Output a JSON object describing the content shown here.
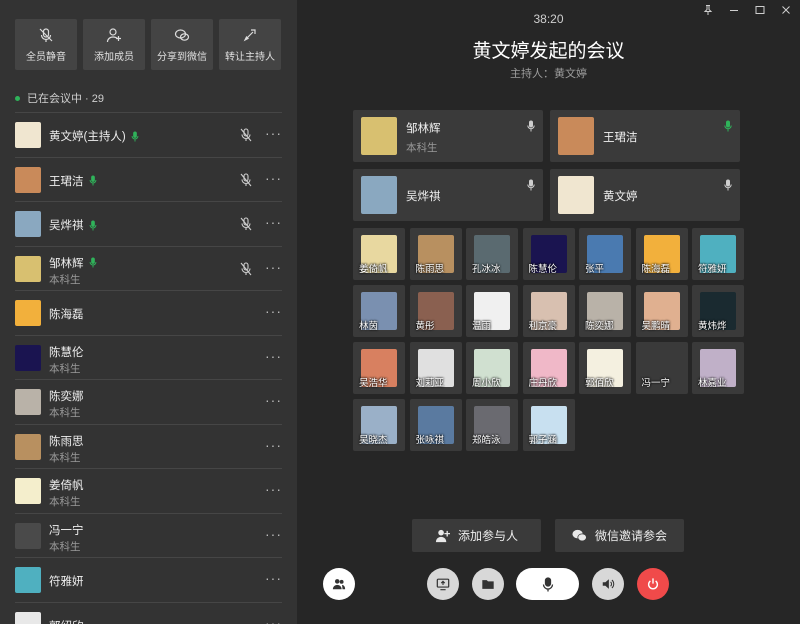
{
  "toolbar": {
    "mute_all": "全员静音",
    "add_member": "添加成员",
    "share_wechat": "分享到微信",
    "transfer_host": "转让主持人"
  },
  "status": {
    "in_meeting": "已在会议中 · 29"
  },
  "members": [
    {
      "name": "黄文婷(主持人)",
      "sub": "",
      "speaking": true,
      "muted": true,
      "color": "#f0e6d0"
    },
    {
      "name": "王珺洁",
      "sub": "",
      "speaking": true,
      "muted": true,
      "color": "#c98a5a"
    },
    {
      "name": "吴烨祺",
      "sub": "",
      "speaking": true,
      "muted": true,
      "color": "#8aa8c0"
    },
    {
      "name": "邹林辉",
      "sub": "本科生",
      "speaking": true,
      "muted": true,
      "color": "#d8c070"
    },
    {
      "name": "陈海磊",
      "sub": "",
      "speaking": false,
      "muted": false,
      "color": "#f2b03c"
    },
    {
      "name": "陈慧伦",
      "sub": "本科生",
      "speaking": false,
      "muted": false,
      "color": "#1a1450"
    },
    {
      "name": "陈奕娜",
      "sub": "本科生",
      "speaking": false,
      "muted": false,
      "color": "#b9b2a8"
    },
    {
      "name": "陈雨思",
      "sub": "本科生",
      "speaking": false,
      "muted": false,
      "color": "#b89060"
    },
    {
      "name": "姜倚帆",
      "sub": "本科生",
      "speaking": false,
      "muted": false,
      "color": "#f4eecc"
    },
    {
      "name": "冯一宁",
      "sub": "本科生",
      "speaking": false,
      "muted": false,
      "color": "#4a4a4a"
    },
    {
      "name": "符雅妍",
      "sub": "",
      "speaking": false,
      "muted": false,
      "color": "#4fb0c0"
    },
    {
      "name": "郭绍欣",
      "sub": "",
      "speaking": false,
      "muted": false,
      "color": "#e8e8e8"
    }
  ],
  "window": {
    "time": "38:20",
    "title": "黄文婷发起的会议",
    "host": "主持人：黄文婷"
  },
  "featured": [
    {
      "name": "邹林辉",
      "sub": "本科生",
      "mic_active": false,
      "color": "#d8c070"
    },
    {
      "name": "王珺洁",
      "sub": "",
      "mic_active": true,
      "color": "#c98a5a"
    },
    {
      "name": "吴烨祺",
      "sub": "",
      "mic_active": false,
      "color": "#8aa8c0"
    },
    {
      "name": "黄文婷",
      "sub": "",
      "mic_active": false,
      "color": "#f0e6d0"
    }
  ],
  "grid": [
    {
      "name": "姜倚帆",
      "color": "#e8d8a0"
    },
    {
      "name": "陈雨思",
      "color": "#b89060"
    },
    {
      "name": "孔冰冰",
      "color": "#5a6a70"
    },
    {
      "name": "陈慧伦",
      "color": "#1a1450"
    },
    {
      "name": "张平",
      "color": "#4a7ab0"
    },
    {
      "name": "陈海磊",
      "color": "#f2b03c"
    },
    {
      "name": "符雅妍",
      "color": "#4fb0c0"
    },
    {
      "name": "林茵",
      "color": "#7a90b0"
    },
    {
      "name": "黄彤",
      "color": "#8a6050"
    },
    {
      "name": "温雨",
      "color": "#f0f0f0"
    },
    {
      "name": "利京豪",
      "color": "#d8c0b0"
    },
    {
      "name": "陈奕娜",
      "color": "#b9b2a8"
    },
    {
      "name": "吴鹏晴",
      "color": "#e0b090"
    },
    {
      "name": "黄炜烨",
      "color": "#1a2a30"
    },
    {
      "name": "吴浩华",
      "color": "#d88060"
    },
    {
      "name": "刘莉亚",
      "color": "#e0e0e0"
    },
    {
      "name": "周小欣",
      "color": "#d0e0d0"
    },
    {
      "name": "庄丹欣",
      "color": "#f0b8c8"
    },
    {
      "name": "郭佰欣",
      "color": "#f4f0e0"
    },
    {
      "name": "冯一宁",
      "color": "#3a3a3a"
    },
    {
      "name": "林嘉业",
      "color": "#c0b0c8"
    },
    {
      "name": "吴晓杰",
      "color": "#9ab0c8"
    },
    {
      "name": "张咏祺",
      "color": "#5a7aa0"
    },
    {
      "name": "郑皓泳",
      "color": "#6a6a70"
    },
    {
      "name": "郭子涵",
      "color": "#c8e0f0"
    }
  ],
  "actions": {
    "add_participant": "添加参与人",
    "wechat_invite": "微信邀请参会"
  },
  "colors": {
    "speaking": "#2fb35a",
    "end_call": "#f04a4a",
    "panel": "#333333",
    "stage": "#262626"
  }
}
